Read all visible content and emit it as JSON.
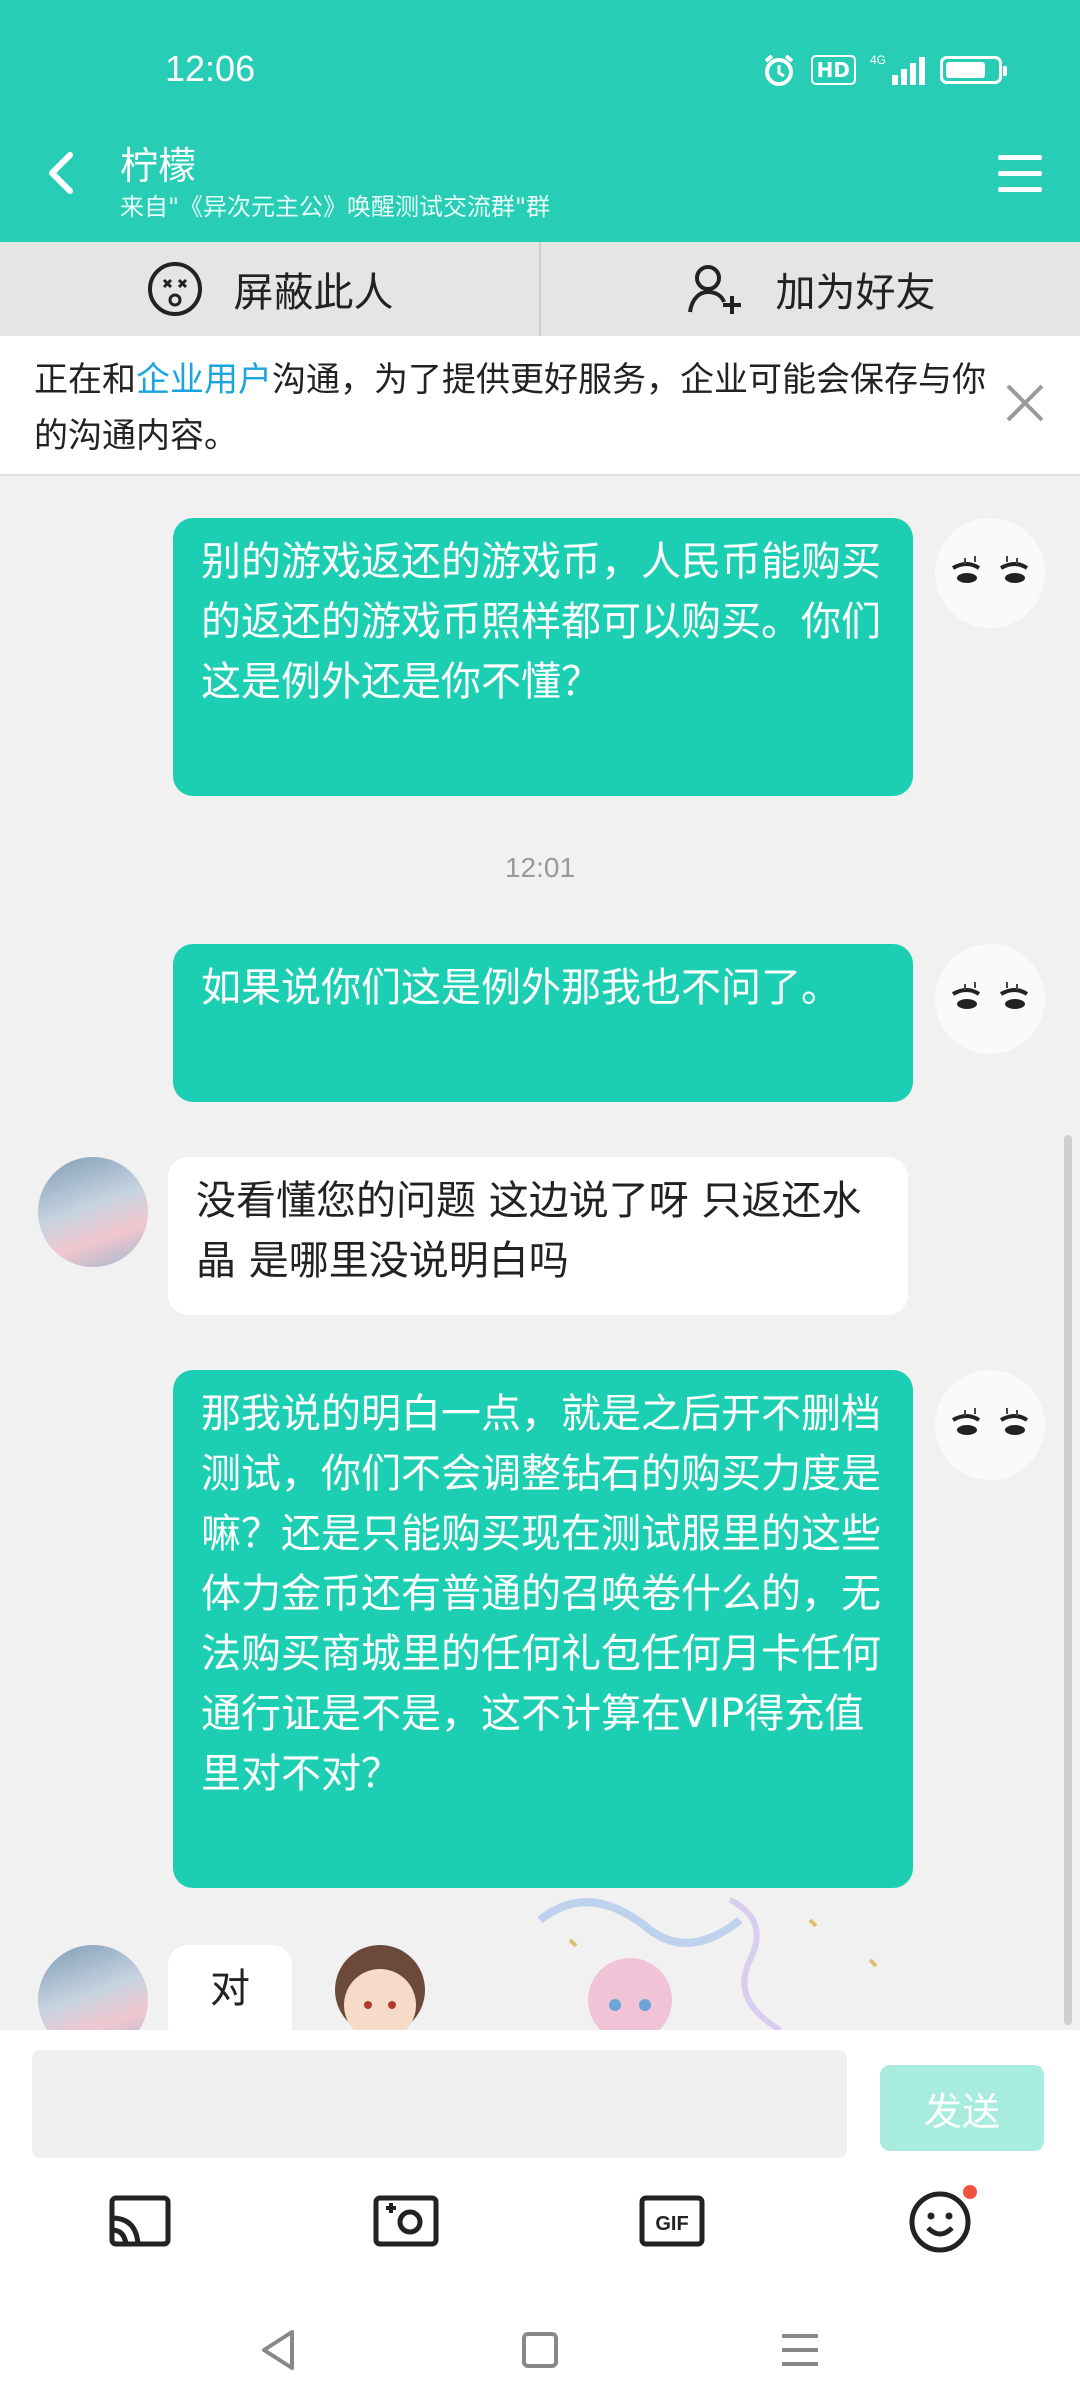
{
  "status": {
    "time": "12:06",
    "hd": "HD",
    "network": "4G"
  },
  "header": {
    "title": "柠檬",
    "subtitle": "来自\"《异次元主公》唤醒测试交流群\"群"
  },
  "actions": {
    "block_label": "屏蔽此人",
    "add_friend_label": "加为好友"
  },
  "notice": {
    "prefix": "正在和",
    "link": "企业用户",
    "suffix": "沟通，为了提供更好服务，企业可能会保存与你的沟通内容。"
  },
  "messages": [
    {
      "side": "mine",
      "text": "别的游戏返还的游戏币，人民币能购买的返还的游戏币照样都可以购买。你们这是例外还是你不懂？"
    },
    {
      "side": "mine",
      "text": "如果说你们这是例外那我也不问了。"
    },
    {
      "side": "theirs",
      "text": "没看懂您的问题 这边说了呀 只返还水晶 是哪里没说明白吗"
    },
    {
      "side": "mine",
      "text": "那我说的明白一点，就是之后开不删档测试，你们不会调整钻石的购买力度是嘛？还是只能购买现在测试服里的这些体力金币还有普通的召唤卷什么的，无法购买商城里的任何礼包任何月卡任何通行证是不是，这不计算在VIP得充值里对不对？"
    },
    {
      "side": "theirs",
      "text": "对"
    }
  ],
  "timestamp": "12:01",
  "composer": {
    "send_label": "发送",
    "placeholder": ""
  },
  "colors": {
    "accent": "#27cdb4",
    "bubble_mine": "#1ccfb2",
    "link": "#1aa5e0",
    "badge": "#f0533f"
  }
}
